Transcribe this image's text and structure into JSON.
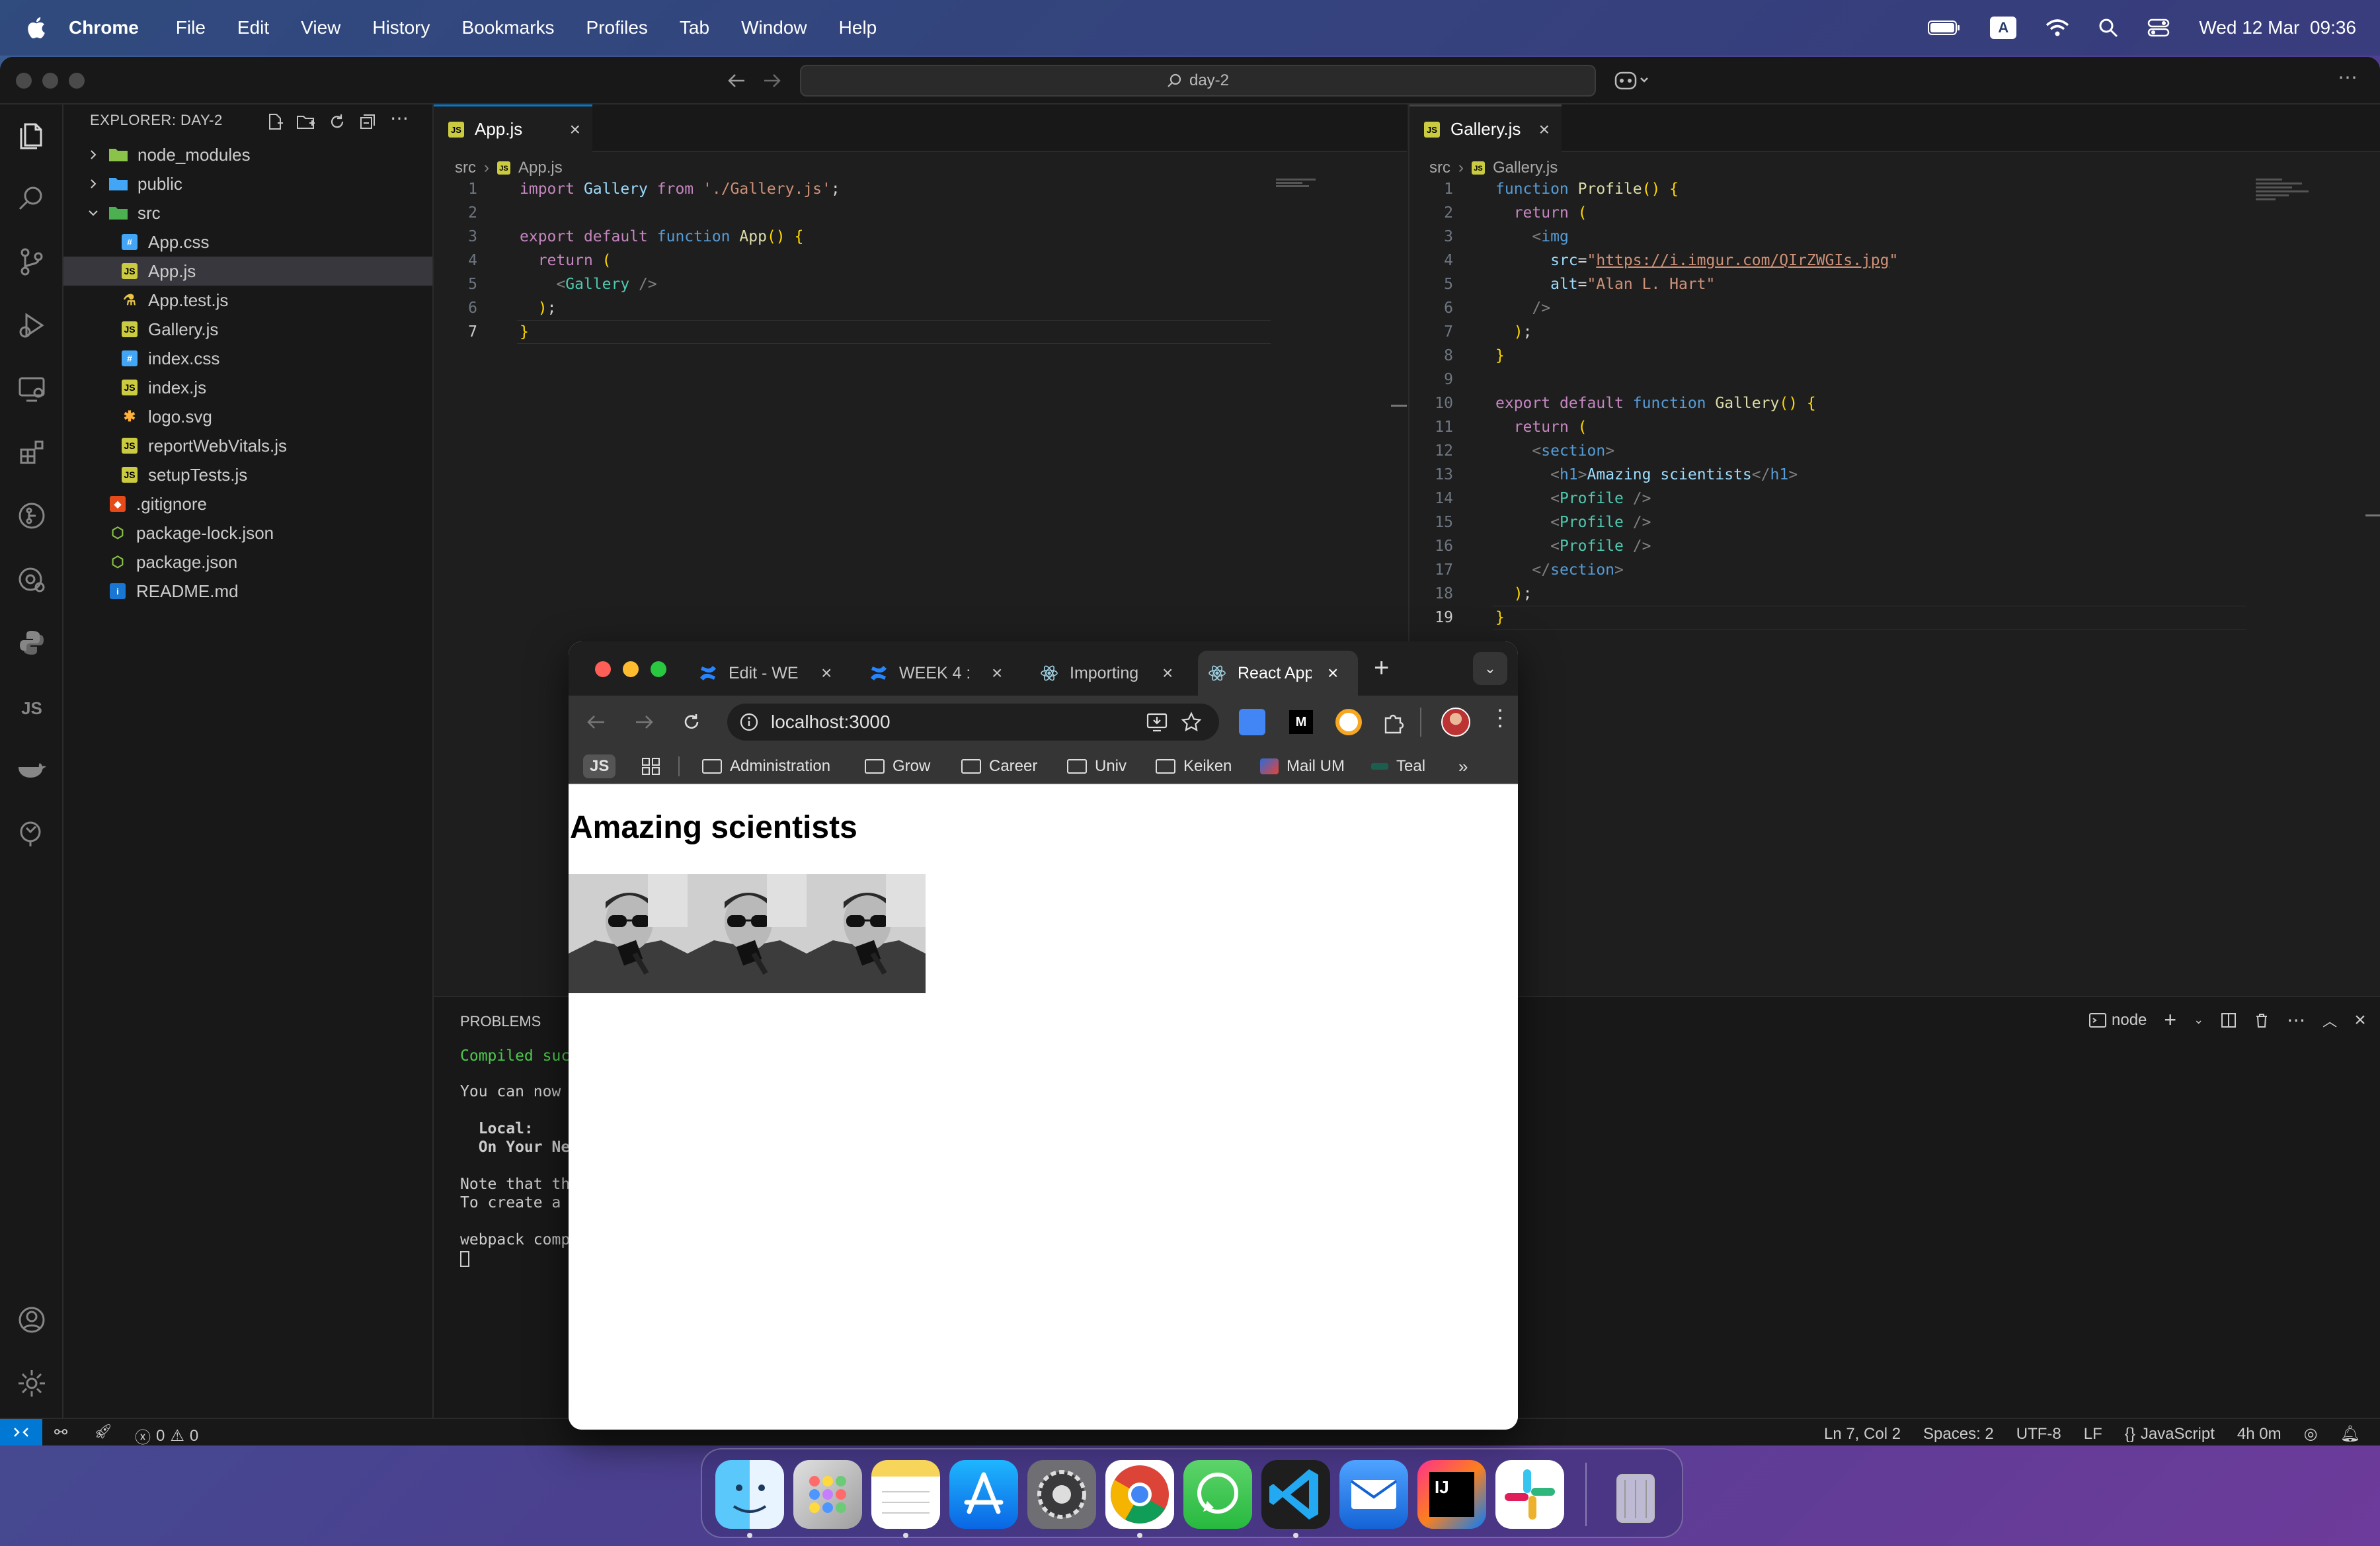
{
  "menubar": {
    "app": "Chrome",
    "items": [
      "File",
      "Edit",
      "View",
      "History",
      "Bookmarks",
      "Profiles",
      "Tab",
      "Window",
      "Help"
    ],
    "clock": "Wed 12 Mar  09:36",
    "input_badge": "A"
  },
  "vscode": {
    "search": "day-2",
    "explorer_title": "EXPLORER: DAY-2",
    "tree": [
      {
        "label": "node_modules",
        "kind": "folder",
        "depth": 0,
        "icon_color": "#8bc34a"
      },
      {
        "label": "public",
        "kind": "folder",
        "depth": 0,
        "icon_color": "#42a5f5"
      },
      {
        "label": "src",
        "kind": "folder-open",
        "depth": 0,
        "icon_color": "#4caf50"
      },
      {
        "label": "App.css",
        "kind": "css",
        "depth": 1
      },
      {
        "label": "App.js",
        "kind": "js",
        "depth": 1,
        "selected": true
      },
      {
        "label": "App.test.js",
        "kind": "test",
        "depth": 1
      },
      {
        "label": "Gallery.js",
        "kind": "js",
        "depth": 1
      },
      {
        "label": "index.css",
        "kind": "css",
        "depth": 1
      },
      {
        "label": "index.js",
        "kind": "js",
        "depth": 1
      },
      {
        "label": "logo.svg",
        "kind": "svg",
        "depth": 1
      },
      {
        "label": "reportWebVitals.js",
        "kind": "js",
        "depth": 1
      },
      {
        "label": "setupTests.js",
        "kind": "js",
        "depth": 1
      },
      {
        "label": ".gitignore",
        "kind": "git",
        "depth": 0
      },
      {
        "label": "package-lock.json",
        "kind": "npm",
        "depth": 0
      },
      {
        "label": "package.json",
        "kind": "npm",
        "depth": 0
      },
      {
        "label": "README.md",
        "kind": "info",
        "depth": 0
      }
    ],
    "left_editor": {
      "tab": "App.js",
      "crumbs": [
        "src",
        "App.js"
      ],
      "active_line": "7",
      "lines": [
        {
          "n": "1",
          "code": "import Gallery from './Gallery.js';"
        },
        {
          "n": "2",
          "code": ""
        },
        {
          "n": "3",
          "code": "export default function App() {"
        },
        {
          "n": "4",
          "code": "  return ("
        },
        {
          "n": "5",
          "code": "    <Gallery />"
        },
        {
          "n": "6",
          "code": "  );"
        },
        {
          "n": "7",
          "code": "}"
        }
      ]
    },
    "right_editor": {
      "tab": "Gallery.js",
      "crumbs": [
        "src",
        "Gallery.js"
      ],
      "active_line": "19",
      "lines": [
        {
          "n": "1",
          "code": "function Profile() {"
        },
        {
          "n": "2",
          "code": "  return ("
        },
        {
          "n": "3",
          "code": "    <img"
        },
        {
          "n": "4",
          "code": "      src=\"https://i.imgur.com/QIrZWGIs.jpg\""
        },
        {
          "n": "5",
          "code": "      alt=\"Alan L. Hart\""
        },
        {
          "n": "6",
          "code": "    />"
        },
        {
          "n": "7",
          "code": "  );"
        },
        {
          "n": "8",
          "code": "}"
        },
        {
          "n": "9",
          "code": ""
        },
        {
          "n": "10",
          "code": "export default function Gallery() {"
        },
        {
          "n": "11",
          "code": "  return ("
        },
        {
          "n": "12",
          "code": "    <section>"
        },
        {
          "n": "13",
          "code": "      <h1>Amazing scientists</h1>"
        },
        {
          "n": "14",
          "code": "      <Profile />"
        },
        {
          "n": "15",
          "code": "      <Profile />"
        },
        {
          "n": "16",
          "code": "      <Profile />"
        },
        {
          "n": "17",
          "code": "    </section>"
        },
        {
          "n": "18",
          "code": "  );"
        },
        {
          "n": "19",
          "code": "}"
        }
      ]
    },
    "panel": {
      "tab": "PROBLEMS",
      "terminal_name": "node",
      "lines": [
        "Compiled suc",
        "You can now",
        "  Local:",
        "  On Your Ne",
        "Note that th",
        "To create a",
        "webpack comp"
      ]
    },
    "status": {
      "errors": "0",
      "warnings": "0",
      "position": "Ln 7, Col 2",
      "spaces": "Spaces: 2",
      "encoding": "UTF-8",
      "eol": "LF",
      "language": "JavaScript",
      "time": "4h 0m"
    }
  },
  "chrome": {
    "tabs": [
      {
        "title": "Edit - WE",
        "icon": "confluence"
      },
      {
        "title": "WEEK 4 :",
        "icon": "confluence"
      },
      {
        "title": "Importing",
        "icon": "react"
      },
      {
        "title": "React App",
        "icon": "react",
        "active": true
      }
    ],
    "url": "localhost:3000",
    "bookmarks": [
      {
        "label": "Administration",
        "type": "folder"
      },
      {
        "label": "Grow",
        "type": "folder"
      },
      {
        "label": "Career",
        "type": "folder"
      },
      {
        "label": "Univ",
        "type": "folder"
      },
      {
        "label": "Keiken",
        "type": "folder"
      },
      {
        "label": "Mail UM",
        "type": "mail"
      },
      {
        "label": "Teal",
        "type": "site"
      }
    ],
    "js_badge": "JS",
    "medium_badge": "M",
    "page": {
      "heading": "Amazing scientists",
      "image_alt": "Alan L. Hart",
      "image_count": 3
    }
  },
  "dock": {
    "apps": [
      "Finder",
      "Launchpad",
      "Notes",
      "App Store",
      "System Settings",
      "Chrome",
      "WhatsApp",
      "VS Code",
      "Mail",
      "IntelliJ IDEA",
      "Slack",
      "Trash"
    ],
    "ij_label": "IJ"
  }
}
